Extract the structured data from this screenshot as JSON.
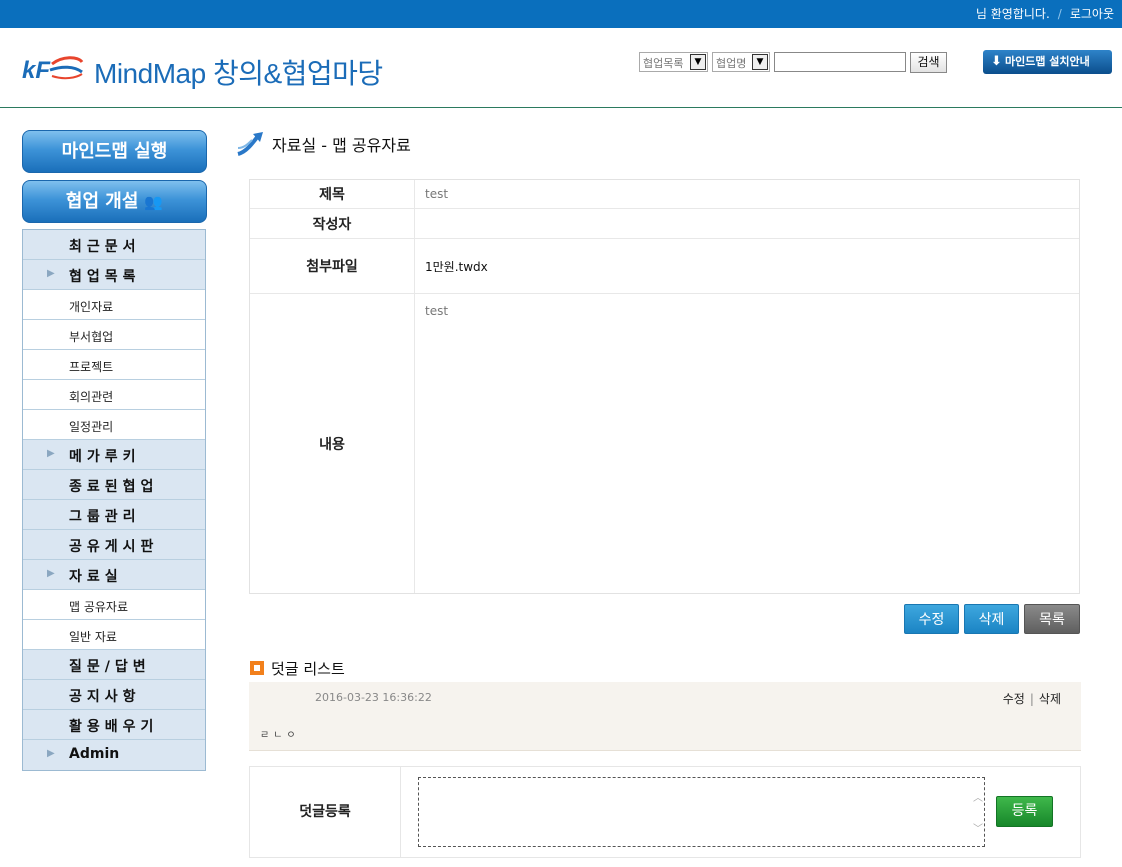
{
  "topbar": {
    "welcome": "님 환영합니다.",
    "separator": "/",
    "logout": "로그아웃"
  },
  "header": {
    "brand": "MindMap 창의&협업마당",
    "search_type_value": "협업목록",
    "search_field_value": "협업명",
    "search_input_value": "",
    "search_button": "검색",
    "install_button": "마인드맵 설치안내"
  },
  "sidebar": {
    "run_button": "마인드맵 실행",
    "collab_button": "협업 개설",
    "items": [
      {
        "label": "최근문서",
        "type": "main",
        "arrow": false
      },
      {
        "label": "협업목록",
        "type": "main",
        "arrow": true
      },
      {
        "label": "개인자료",
        "type": "sub"
      },
      {
        "label": "부서협업",
        "type": "sub"
      },
      {
        "label": "프로젝트",
        "type": "sub"
      },
      {
        "label": "회의관련",
        "type": "sub"
      },
      {
        "label": "일정관리",
        "type": "sub"
      },
      {
        "label": "메가루키",
        "type": "main",
        "arrow": true
      },
      {
        "label": "종료된협업",
        "type": "main",
        "arrow": false
      },
      {
        "label": "그룹관리",
        "type": "main",
        "arrow": false
      },
      {
        "label": "공유게시판",
        "type": "main",
        "arrow": false
      },
      {
        "label": "자료실",
        "type": "main",
        "arrow": true
      },
      {
        "label": "맵 공유자료",
        "type": "sub"
      },
      {
        "label": "일반 자료",
        "type": "sub"
      },
      {
        "label": "질문/답변",
        "type": "main",
        "arrow": false
      },
      {
        "label": "공지사항",
        "type": "main",
        "arrow": false
      },
      {
        "label": "활용배우기",
        "type": "main",
        "arrow": false
      },
      {
        "label": "Admin",
        "type": "main",
        "arrow": true
      }
    ]
  },
  "page": {
    "title": "자료실 - 맵 공유자료"
  },
  "detail": {
    "title_label": "제목",
    "title_value": "test",
    "writer_label": "작성자",
    "writer_value": "",
    "file_label": "첨부파일",
    "file_value": "1만원.twdx",
    "content_label": "내용",
    "content_value": "test"
  },
  "actions": {
    "edit": "수정",
    "delete": "삭제",
    "list": "목록"
  },
  "comments": {
    "title": "덧글 리스트",
    "items": [
      {
        "date": "2016-03-23 16:36:22",
        "edit": "수정",
        "delete": "삭제",
        "text": "ㄹㄴㅇ"
      }
    ],
    "register_label": "덧글등록",
    "register_button": "등록",
    "input_value": ""
  },
  "colors": {
    "topbar": "#0a6fbd",
    "brand": "#1b6cb8",
    "accent_orange": "#f2801c",
    "submit_green": "#17872a"
  }
}
